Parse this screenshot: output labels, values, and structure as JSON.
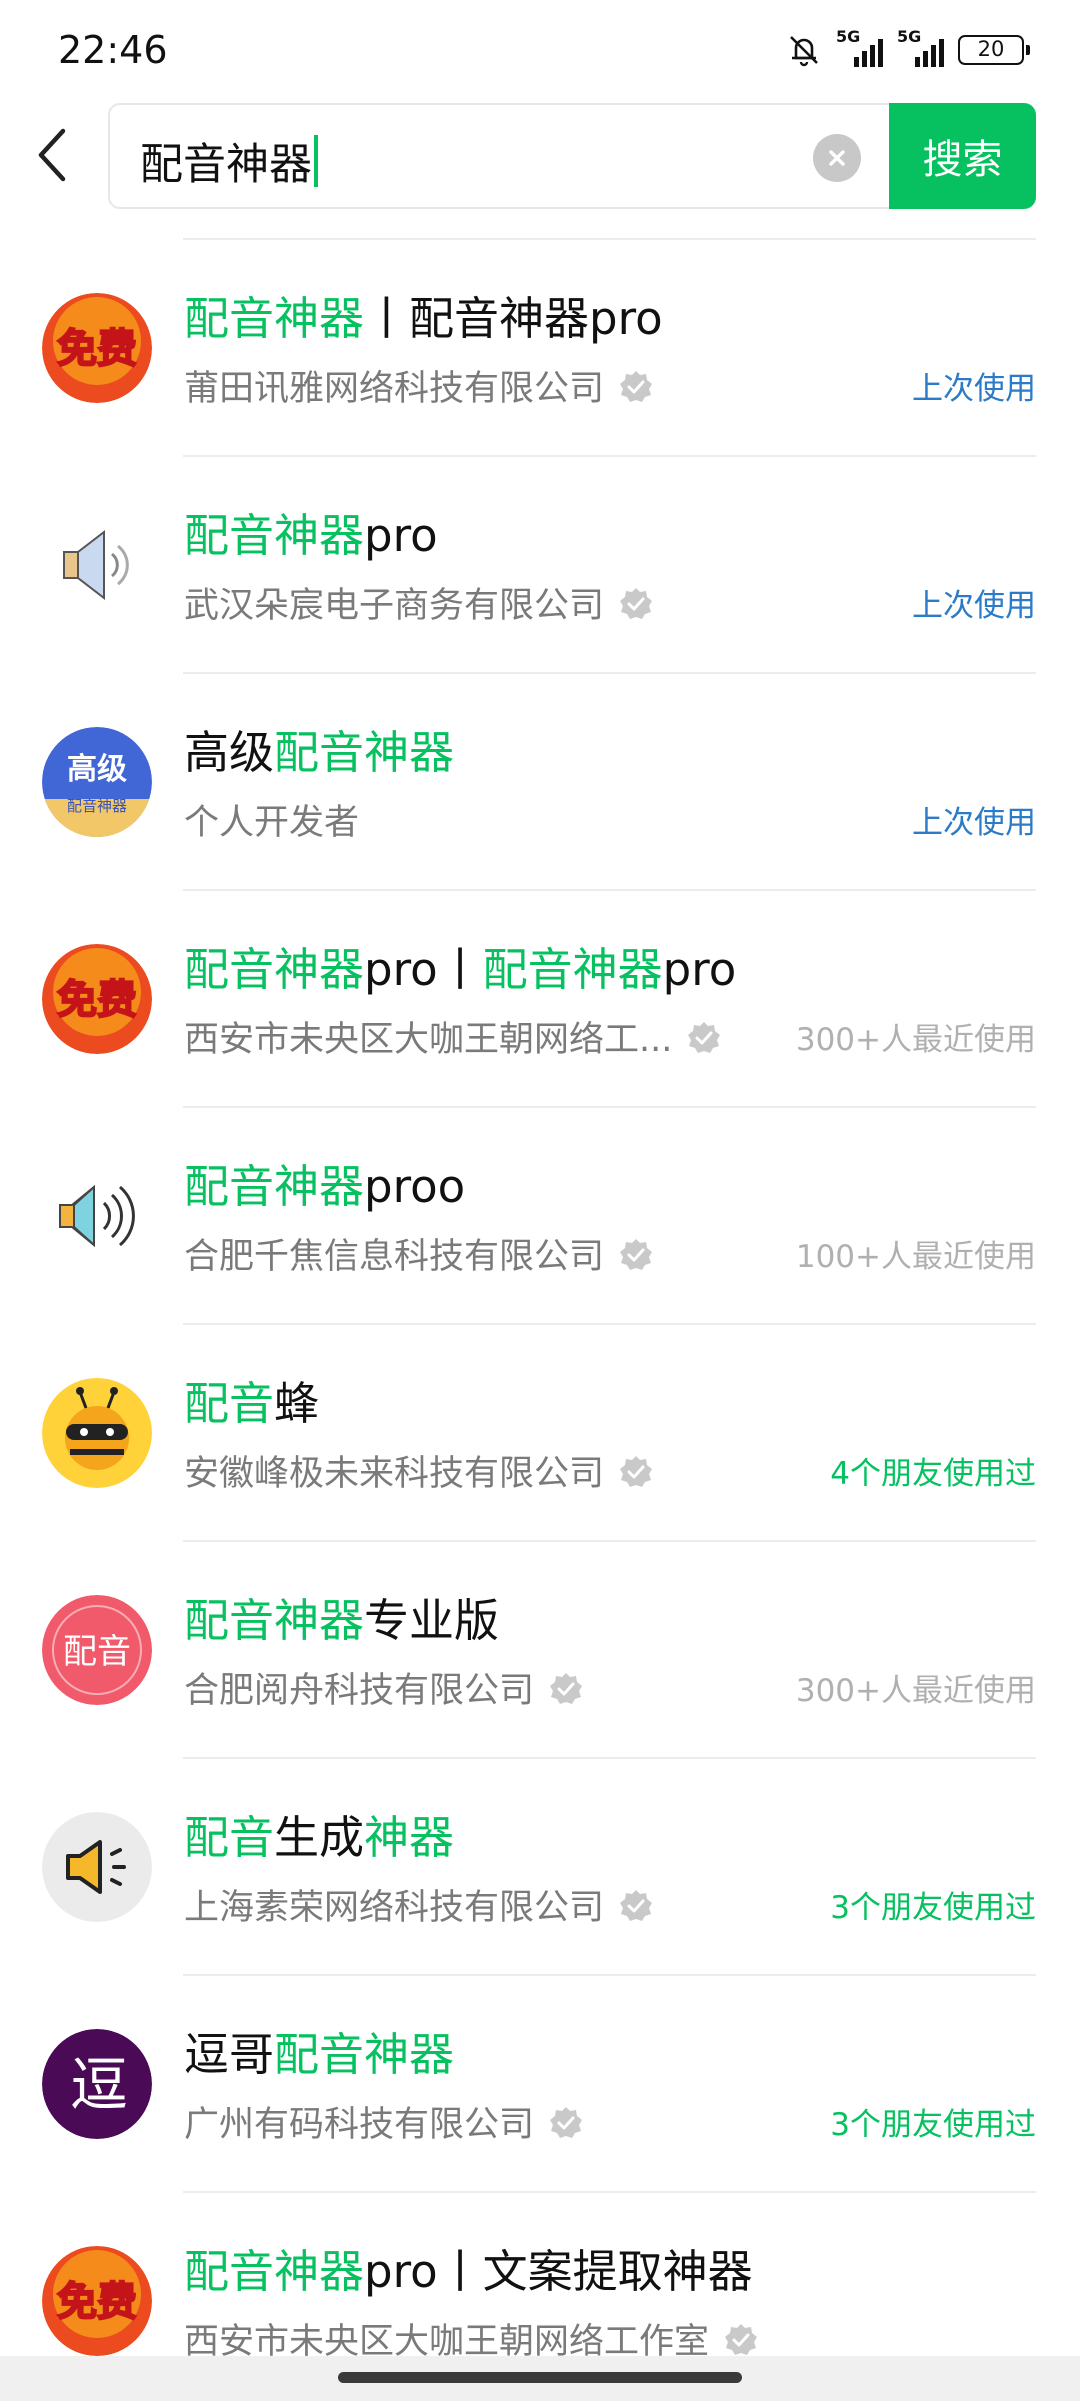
{
  "status_bar": {
    "time": "22:46",
    "network_1": "5G",
    "network_2": "5G",
    "battery": "20",
    "icons": [
      "bell-off-icon",
      "signal-icon",
      "signal-icon",
      "battery-icon"
    ]
  },
  "search": {
    "value": "配音神器",
    "button_label": "搜索",
    "back_icon": "chevron-left-icon",
    "clear_icon": "clear-icon"
  },
  "results": [
    {
      "title": [
        {
          "t": "配音神器",
          "hl": true
        },
        {
          "t": "丨配音神器pro",
          "hl": false
        }
      ],
      "company": "莆田讯雅网络科技有限公司",
      "usage": "上次使用",
      "usage_color": "#2b7bc7",
      "icon": "free-badge-icon"
    },
    {
      "title": [
        {
          "t": "配音神器",
          "hl": true
        },
        {
          "t": "pro",
          "hl": false
        }
      ],
      "company": "武汉朵宸电子商务有限公司",
      "usage": "上次使用",
      "usage_color": "#2b7bc7",
      "icon": "speaker-icon"
    },
    {
      "title": [
        {
          "t": "高级",
          "hl": false
        },
        {
          "t": "配音神器",
          "hl": true
        }
      ],
      "company": "个人开发者",
      "usage": "上次使用",
      "usage_color": "#2b7bc7",
      "icon": "advanced-dubbing-icon",
      "icon_text": "高级",
      "icon_subtext": "配音神器",
      "verified": false
    },
    {
      "title": [
        {
          "t": "配音神器",
          "hl": true
        },
        {
          "t": "pro丨",
          "hl": false
        },
        {
          "t": "配音神器",
          "hl": true
        },
        {
          "t": "pro",
          "hl": false
        }
      ],
      "company": "西安市未央区大咖王朝网络工...",
      "usage": "300+人最近使用",
      "usage_color": "#b0b0b0",
      "icon": "free-badge-icon"
    },
    {
      "title": [
        {
          "t": "配音神器",
          "hl": true
        },
        {
          "t": "proo",
          "hl": false
        }
      ],
      "company": "合肥千焦信息科技有限公司",
      "usage": "100+人最近使用",
      "usage_color": "#b0b0b0",
      "icon": "speaker-waves-icon"
    },
    {
      "title": [
        {
          "t": "配音",
          "hl": true
        },
        {
          "t": "蜂",
          "hl": false
        }
      ],
      "company": "安徽峰极未来科技有限公司",
      "usage": "4个朋友使用过",
      "usage_color": "#07c160",
      "icon": "bee-icon"
    },
    {
      "title": [
        {
          "t": "配音神器",
          "hl": true
        },
        {
          "t": "专业版",
          "hl": false
        }
      ],
      "company": "合肥阅舟科技有限公司",
      "usage": "300+人最近使用",
      "usage_color": "#b0b0b0",
      "icon": "dubbing-text-icon",
      "icon_text": "配音"
    },
    {
      "title": [
        {
          "t": "配音",
          "hl": true
        },
        {
          "t": "生成",
          "hl": false
        },
        {
          "t": "神器",
          "hl": true
        }
      ],
      "company": "上海素荣网络科技有限公司",
      "usage": "3个朋友使用过",
      "usage_color": "#07c160",
      "icon": "loudspeaker-icon"
    },
    {
      "title": [
        {
          "t": "逗哥",
          "hl": false
        },
        {
          "t": "配音神器",
          "hl": true
        }
      ],
      "company": "广州有码科技有限公司",
      "usage": "3个朋友使用过",
      "usage_color": "#07c160",
      "icon": "dou-logo-icon",
      "icon_text": "逗"
    },
    {
      "title": [
        {
          "t": "配音神器",
          "hl": true
        },
        {
          "t": "pro丨文案提取神器",
          "hl": false
        }
      ],
      "company": "西安市未央区大咖王朝网络工作室",
      "usage": "",
      "usage_color": "#b0b0b0",
      "icon": "free-badge-icon"
    }
  ],
  "free_badge_text": "免费",
  "colors": {
    "accent": "#07c160",
    "link_blue": "#2b7bc7",
    "muted": "#7a7a7a"
  }
}
